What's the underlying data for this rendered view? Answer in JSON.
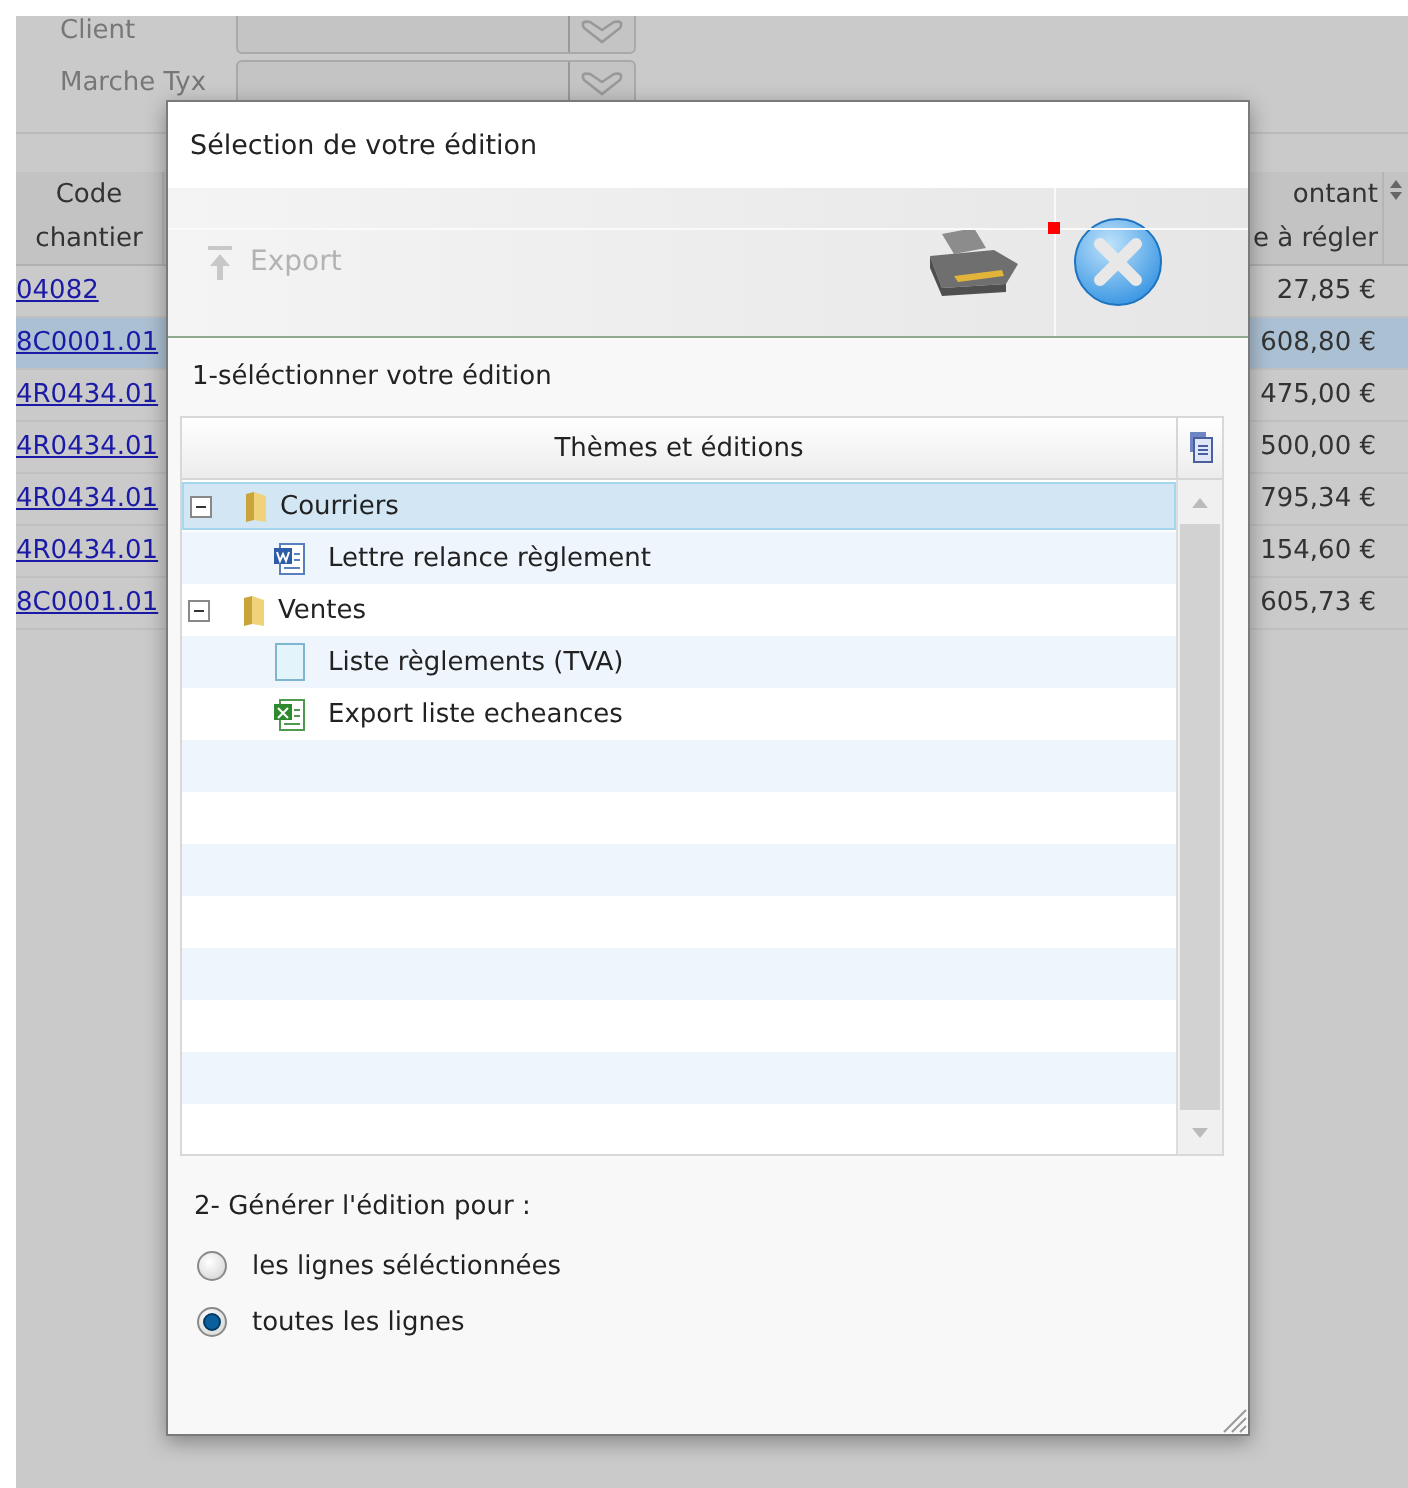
{
  "background": {
    "filters": [
      {
        "label": "Client"
      },
      {
        "label": "Marche Tyx"
      }
    ],
    "table": {
      "columns": [
        {
          "lines": [
            "Code",
            "chantier"
          ]
        },
        {
          "lines": [
            "ontant",
            "e à régler"
          ]
        }
      ],
      "rows": [
        {
          "cells": [
            "04082",
            "27,85 €"
          ],
          "selected": false
        },
        {
          "cells": [
            "8C0001.01",
            "608,80 €"
          ],
          "selected": true
        },
        {
          "cells": [
            "4R0434.01",
            "475,00 €"
          ],
          "selected": false
        },
        {
          "cells": [
            "4R0434.01",
            "500,00 €"
          ],
          "selected": false
        },
        {
          "cells": [
            "4R0434.01",
            "795,34 €"
          ],
          "selected": false
        },
        {
          "cells": [
            "4R0434.01",
            "154,60 €"
          ],
          "selected": false
        },
        {
          "cells": [
            "8C0001.01",
            "605,73 €"
          ],
          "selected": false
        }
      ]
    }
  },
  "dialog": {
    "title": "Sélection de votre édition",
    "toolbar": {
      "export": {
        "label": "Export",
        "disabled": true
      }
    },
    "step_1": "1-séléctionner votre édition",
    "tree": {
      "header": "Thèmes et éditions",
      "items": [
        {
          "label": "Courriers",
          "kind": "folder",
          "expanded": true,
          "selected": true,
          "children": [
            {
              "label": "Lettre relance règlement",
              "kind": "word",
              "selected": false
            }
          ]
        },
        {
          "label": "Ventes",
          "kind": "folder",
          "expanded": true,
          "selected": false,
          "children": [
            {
              "label": "Liste règlements (TVA)",
              "kind": "blank",
              "selected": false
            },
            {
              "label": "Export liste echeances",
              "kind": "excel",
              "selected": false
            }
          ]
        }
      ]
    },
    "step_2": "2- Générer l'édition pour :",
    "options": [
      {
        "label": "les lignes séléctionnées",
        "selected": false
      },
      {
        "label": "toutes les lignes",
        "selected": true
      }
    ]
  }
}
